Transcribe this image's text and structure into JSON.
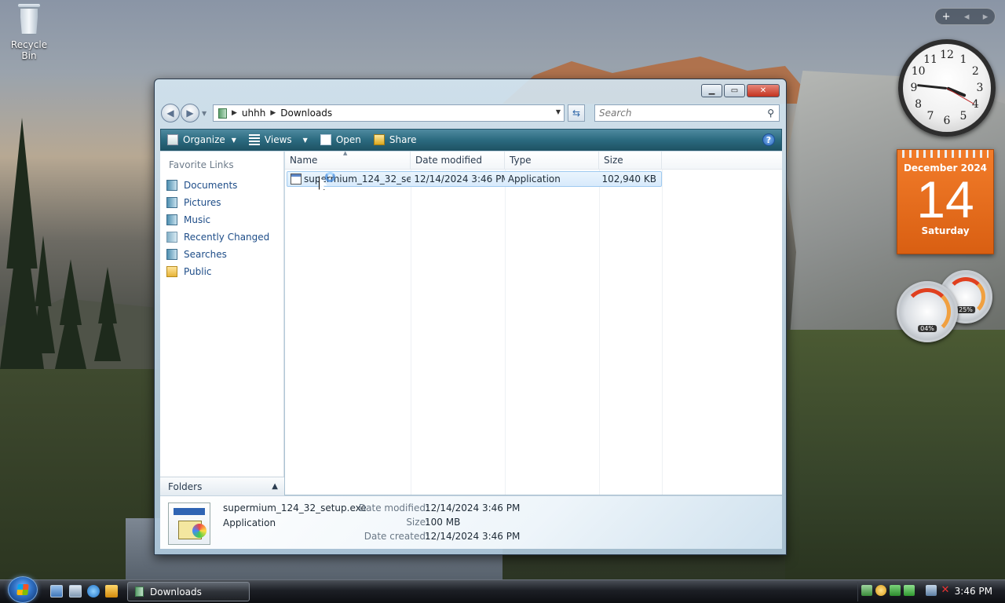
{
  "desktop": {
    "recycle_bin_label": "Recycle Bin"
  },
  "gadgets": {
    "clock_numbers": [
      "12",
      "1",
      "2",
      "3",
      "4",
      "5",
      "6",
      "7",
      "8",
      "9",
      "10",
      "11"
    ],
    "calendar": {
      "month_year": "December 2024",
      "day": "14",
      "weekday": "Saturday"
    },
    "cpu_meter": {
      "cpu_percent": "04%",
      "memory_percent": "25%"
    },
    "toolbar_add": "+",
    "toolbar_prev": "◂",
    "toolbar_next": "▸"
  },
  "window": {
    "address": {
      "segments": [
        "uhhh",
        "Downloads"
      ]
    },
    "search": {
      "placeholder": "Search"
    },
    "toolbar": {
      "organize": "Organize",
      "views": "Views",
      "open": "Open",
      "share": "Share",
      "help": "?"
    },
    "nav": {
      "favorite_links_title": "Favorite Links",
      "items": [
        {
          "label": "Documents",
          "icon": "documents-icon"
        },
        {
          "label": "Pictures",
          "icon": "pictures-icon"
        },
        {
          "label": "Music",
          "icon": "music-icon"
        },
        {
          "label": "Recently Changed",
          "icon": "recently-changed-icon"
        },
        {
          "label": "Searches",
          "icon": "searches-icon"
        },
        {
          "label": "Public",
          "icon": "folder-icon"
        }
      ],
      "folders_label": "Folders"
    },
    "columns": [
      "Name",
      "Date modified",
      "Type",
      "Size"
    ],
    "files": [
      {
        "name": "supermium_124_32_set...",
        "date_modified": "12/14/2024 3:46 PM",
        "type": "Application",
        "size": "102,940 KB"
      }
    ],
    "details": {
      "file_name": "supermium_124_32_setup.exe",
      "file_type": "Application",
      "date_modified_label": "Date modified:",
      "date_modified": "12/14/2024 3:46 PM",
      "size_label": "Size:",
      "size": "100 MB",
      "date_created_label": "Date created:",
      "date_created": "12/14/2024 3:46 PM"
    }
  },
  "taskbar": {
    "window_button_label": "Downloads",
    "clock": "3:46 PM"
  },
  "colors": {
    "toolbar": "#2c6b80",
    "link": "#1e4d88",
    "selection": "#d8eafb",
    "calendar": "#e8691c"
  }
}
